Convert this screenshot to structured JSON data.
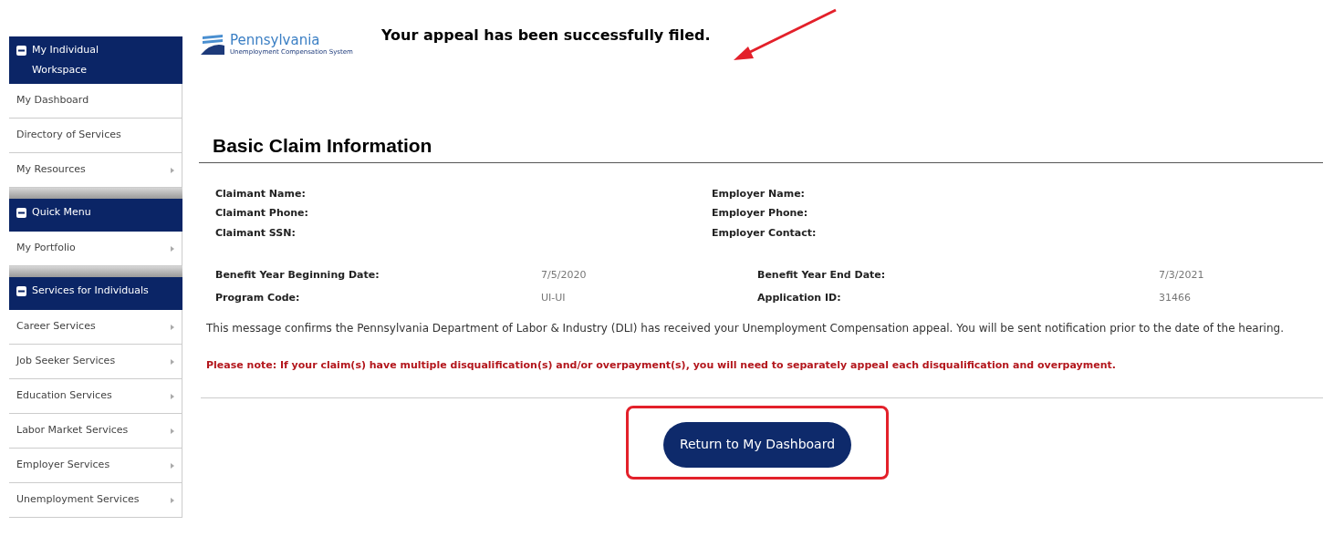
{
  "sidebar": {
    "sections": [
      {
        "title": "My Individual Workspace",
        "expanded": true,
        "items": [
          {
            "label": "My Dashboard",
            "submenu": false
          },
          {
            "label": "Directory of Services",
            "submenu": false
          },
          {
            "label": "My Resources",
            "submenu": true
          }
        ]
      },
      {
        "title": "Quick Menu",
        "expanded": true,
        "items": [
          {
            "label": "My Portfolio",
            "submenu": true
          }
        ]
      },
      {
        "title": "Services for Individuals",
        "expanded": true,
        "items": [
          {
            "label": "Career Services",
            "submenu": true
          },
          {
            "label": "Job Seeker Services",
            "submenu": true
          },
          {
            "label": "Education Services",
            "submenu": true
          },
          {
            "label": "Labor Market Services",
            "submenu": true
          },
          {
            "label": "Employer Services",
            "submenu": true
          },
          {
            "label": "Unemployment Services",
            "submenu": true
          }
        ]
      }
    ]
  },
  "logo": {
    "name": "Pennsylvania",
    "subtitle": "Unemployment Compensation System"
  },
  "message": "Your appeal has been successfully filed.",
  "section_title": "Basic Claim Information",
  "parties": {
    "left": [
      "Claimant Name:",
      "Claimant Phone:",
      "Claimant SSN:"
    ],
    "right": [
      "Employer Name:",
      "Employer Phone:",
      "Employer Contact:"
    ]
  },
  "details": [
    {
      "label": "Benefit Year Beginning Date:",
      "value": "7/5/2020",
      "label2": "Benefit Year End Date:",
      "value2": "7/3/2021"
    },
    {
      "label": "Program Code:",
      "value": "UI-UI",
      "label2": "Application ID:",
      "value2": "31466"
    }
  ],
  "confirmation": "This message confirms the Pennsylvania Department of Labor & Industry (DLI) has received your Unemployment Compensation appeal. You will be sent notification prior to the date of the hearing.",
  "note": "Please note: If your claim(s) have multiple  disqualification(s) and/or overpayment(s), you will need to separately appeal each disqualification and overpayment.",
  "button": "Return to My Dashboard"
}
